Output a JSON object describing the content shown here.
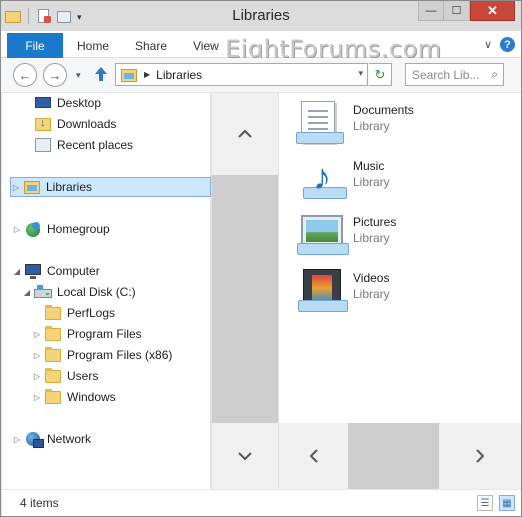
{
  "window": {
    "title": "Libraries",
    "close_glyph": "✕",
    "minimize_glyph": "—",
    "maximize_glyph": "☐"
  },
  "ribbon": {
    "tabs": [
      {
        "label": "File"
      },
      {
        "label": "Home"
      },
      {
        "label": "Share"
      },
      {
        "label": "View"
      }
    ],
    "watermark": "EightForums.com",
    "help_glyph": "?",
    "expand_glyph": "∨"
  },
  "address": {
    "back_glyph": "←",
    "forward_glyph": "→",
    "recent_glyph": "▾",
    "up_glyph": "🡑",
    "crumb": "Libraries",
    "refresh_glyph": "↻",
    "search_placeholder": "Search Lib...",
    "search_glyph": "⌕"
  },
  "nav_pane": {
    "items": [
      {
        "label": "Desktop",
        "icon": "desktop-icon"
      },
      {
        "label": "Downloads",
        "icon": "downloads-icon"
      },
      {
        "label": "Recent places",
        "icon": "recent-places-icon"
      },
      {
        "label": "Libraries",
        "icon": "libraries-icon",
        "selected": true
      },
      {
        "label": "Homegroup",
        "icon": "homegroup-icon"
      },
      {
        "label": "Computer",
        "icon": "computer-icon"
      },
      {
        "label": "Local Disk (C:)",
        "icon": "disk-icon"
      },
      {
        "label": "PerfLogs",
        "icon": "folder-icon"
      },
      {
        "label": "Program Files",
        "icon": "folder-icon"
      },
      {
        "label": "Program Files (x86)",
        "icon": "folder-icon"
      },
      {
        "label": "Users",
        "icon": "folder-icon"
      },
      {
        "label": "Windows",
        "icon": "folder-icon"
      },
      {
        "label": "Network",
        "icon": "network-icon"
      }
    ],
    "scroll_up_glyph": "︿",
    "scroll_down_glyph": "﹀"
  },
  "content": {
    "libraries": [
      {
        "name": "Documents",
        "type": "Library",
        "icon": "documents-library-icon"
      },
      {
        "name": "Music",
        "type": "Library",
        "icon": "music-library-icon"
      },
      {
        "name": "Pictures",
        "type": "Library",
        "icon": "pictures-library-icon"
      },
      {
        "name": "Videos",
        "type": "Library",
        "icon": "videos-library-icon"
      }
    ],
    "scroll_left_glyph": "‹",
    "scroll_right_glyph": "›"
  },
  "status": {
    "item_count": "4 items",
    "details_view_glyph": "☰",
    "icons_view_glyph": "▦"
  },
  "colors": {
    "file_tab": "#1979ca",
    "close_button": "#c7483b",
    "selection": "#cce8ff"
  }
}
